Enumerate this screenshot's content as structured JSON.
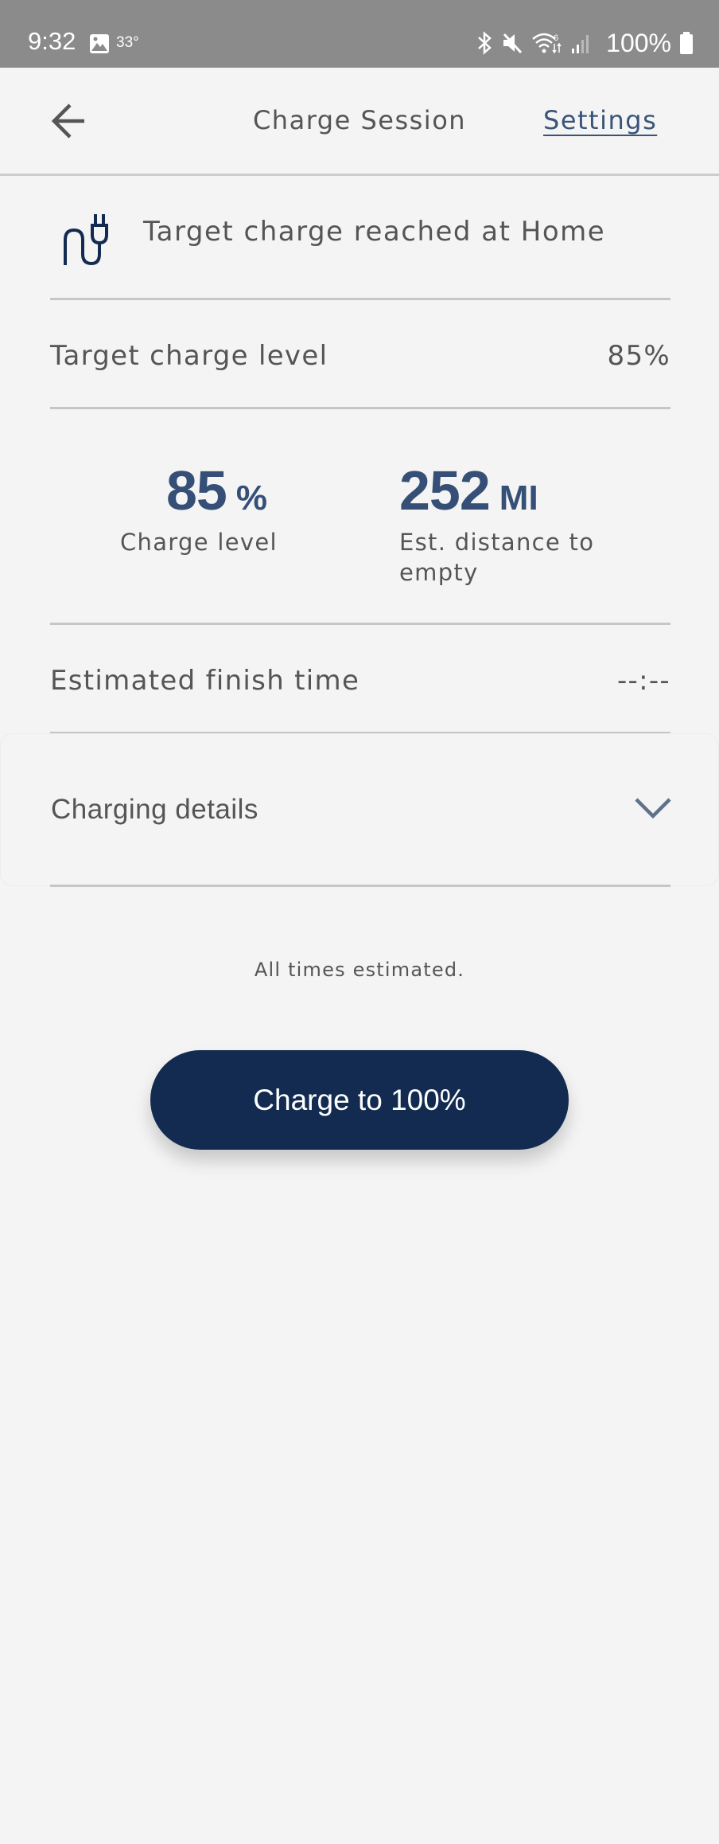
{
  "status_bar": {
    "time": "9:32",
    "temperature": "33°",
    "battery": "100%",
    "icons": [
      "image-icon",
      "bluetooth-icon",
      "mute-icon",
      "wifi-icon",
      "signal-icon",
      "battery-icon"
    ]
  },
  "header": {
    "back_icon": "arrow-left-icon",
    "title": "Charge Session",
    "settings_label": "Settings"
  },
  "status": {
    "icon": "plug-icon",
    "text": "Target charge reached at Home"
  },
  "target_charge": {
    "label": "Target charge level",
    "value": "85%"
  },
  "stats": {
    "charge": {
      "value": "85",
      "unit": "%",
      "label": "Charge level"
    },
    "distance": {
      "value": "252",
      "unit": "MI",
      "label": "Est. distance to empty"
    }
  },
  "finish_time": {
    "label": "Estimated finish time",
    "value": "--:--"
  },
  "charging_details": {
    "label": "Charging details",
    "expanded": false,
    "icon": "chevron-down-icon"
  },
  "footnote": "All times estimated.",
  "cta": {
    "label": "Charge to 100%"
  },
  "colors": {
    "accent": "#354f77",
    "link": "#3a5478",
    "button": "#132b50",
    "text": "#555555",
    "background": "#f4f4f4",
    "status_bar": "#8b8b8b"
  }
}
